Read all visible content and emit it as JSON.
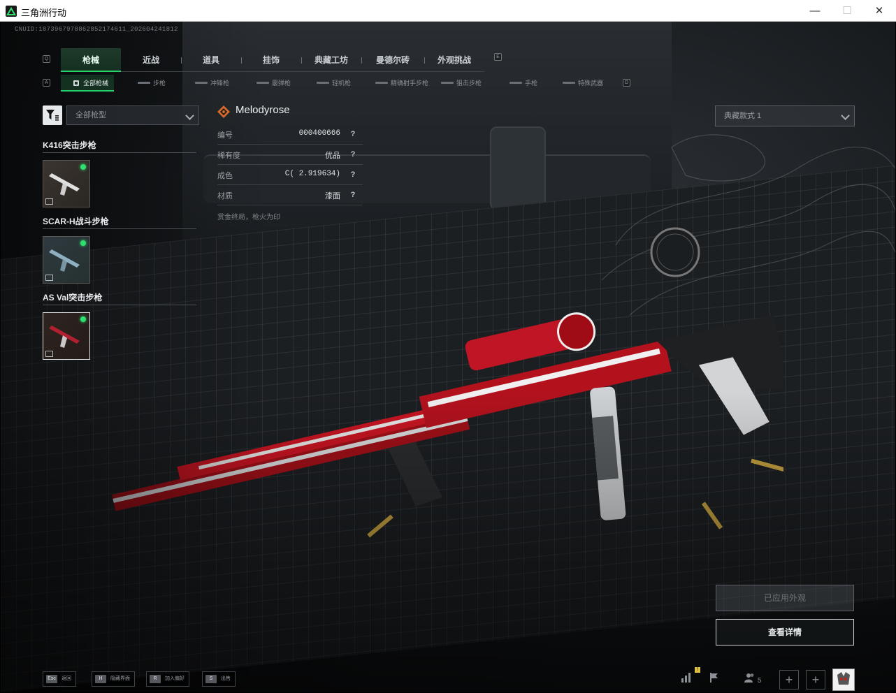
{
  "window": {
    "title": "三角洲行动",
    "minimize": "—",
    "maximize": "☐",
    "close": "✕"
  },
  "uid": "CNUID:1873967978862852174611_202604241812",
  "main_tabs": [
    {
      "label": "枪械",
      "active": true
    },
    {
      "label": "近战",
      "active": false
    },
    {
      "label": "道具",
      "active": false
    },
    {
      "label": "挂饰",
      "active": false
    },
    {
      "label": "典藏工坊",
      "active": false
    },
    {
      "label": "曼德尔砖",
      "active": false
    },
    {
      "label": "外观挑战",
      "active": false
    }
  ],
  "main_tab_keys": {
    "left": "Q",
    "right": "E"
  },
  "sub_tabs": [
    {
      "label": "全部枪械",
      "active": true
    },
    {
      "label": "步枪"
    },
    {
      "label": "冲锋枪"
    },
    {
      "label": "霰弹枪"
    },
    {
      "label": "轻机枪"
    },
    {
      "label": "精确射手步枪"
    },
    {
      "label": "狙击步枪"
    },
    {
      "label": "手枪"
    },
    {
      "label": "特殊武器"
    }
  ],
  "sub_tab_keys": {
    "left": "A",
    "right": "D"
  },
  "filter": {
    "value": "全部枪型"
  },
  "weapon_groups": [
    {
      "title": "K416突击步枪",
      "selected": false
    },
    {
      "title": "SCAR-H战斗步枪",
      "selected": false
    },
    {
      "title": "AS Val突击步枪",
      "selected": true
    }
  ],
  "skin": {
    "name": "Melodyrose",
    "rows": [
      {
        "key": "编号",
        "value": "000400666"
      },
      {
        "key": "稀有度",
        "value": "优品"
      },
      {
        "key": "成色",
        "value": "C( 2.919634)"
      },
      {
        "key": "材质",
        "value": "漆面"
      }
    ],
    "help_glyph": "?",
    "description": "赏金终局，枪火为印"
  },
  "collection_select": {
    "value": "典藏款式 1"
  },
  "buttons": {
    "applied": "已应用外观",
    "detail": "查看详情"
  },
  "bottom_hints": [
    {
      "key": "Esc",
      "label": "返回"
    },
    {
      "key": "H",
      "label": "隐藏界面"
    },
    {
      "key": "R",
      "label": "加入偏好"
    },
    {
      "key": "S",
      "label": "出售"
    }
  ],
  "bottom_right": {
    "friends_count": "5",
    "plus": "+",
    "notif_badge": "!"
  },
  "colors": {
    "accent_green": "#28d26a",
    "skin_red": "#c01020"
  }
}
